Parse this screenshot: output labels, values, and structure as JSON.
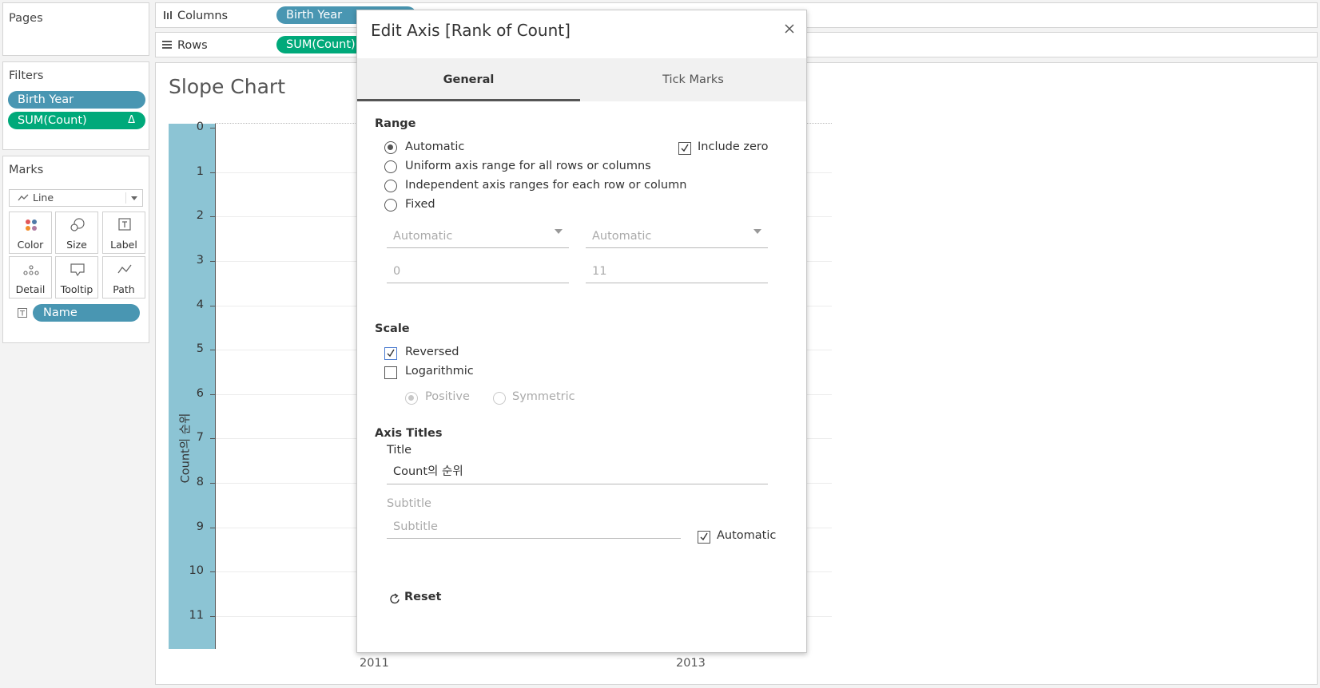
{
  "pages": {
    "title": "Pages"
  },
  "shelves": {
    "columns": {
      "label": "Columns",
      "pill": "Birth Year"
    },
    "rows": {
      "label": "Rows",
      "pill": "SUM(Count)"
    }
  },
  "filters": {
    "title": "Filters",
    "items": [
      {
        "label": "Birth Year"
      },
      {
        "label": "SUM(Count)",
        "badge": "Δ"
      }
    ]
  },
  "marks": {
    "title": "Marks",
    "type": "Line",
    "buttons": [
      "Color",
      "Size",
      "Label",
      "Detail",
      "Tooltip",
      "Path"
    ],
    "label_field": "Name"
  },
  "sheet": {
    "title": "Slope Chart",
    "axis_title": "Count의 순위",
    "y_ticks": [
      "0",
      "1",
      "2",
      "3",
      "4",
      "5",
      "6",
      "7",
      "8",
      "9",
      "10",
      "11"
    ],
    "x_ticks": [
      "2011",
      "2013"
    ]
  },
  "dialog": {
    "title": "Edit Axis [Rank of Count]",
    "tabs": [
      "General",
      "Tick Marks"
    ],
    "range": {
      "heading": "Range",
      "options": [
        "Automatic",
        "Uniform axis range for all rows or columns",
        "Independent axis ranges for each row or column",
        "Fixed"
      ],
      "selected": "Automatic",
      "include_zero_label": "Include zero",
      "include_zero_checked": true,
      "start_mode": "Automatic",
      "end_mode": "Automatic",
      "start_value": "0",
      "end_value": "11"
    },
    "scale": {
      "heading": "Scale",
      "reversed_label": "Reversed",
      "reversed_checked": true,
      "logarithmic_label": "Logarithmic",
      "logarithmic_checked": false,
      "positive_label": "Positive",
      "symmetric_label": "Symmetric"
    },
    "axis_titles": {
      "heading": "Axis Titles",
      "title_label": "Title",
      "title_value": "Count의 순위",
      "subtitle_label": "Subtitle",
      "subtitle_placeholder": "Subtitle",
      "automatic_label": "Automatic",
      "automatic_checked": true
    },
    "reset_label": "Reset"
  }
}
